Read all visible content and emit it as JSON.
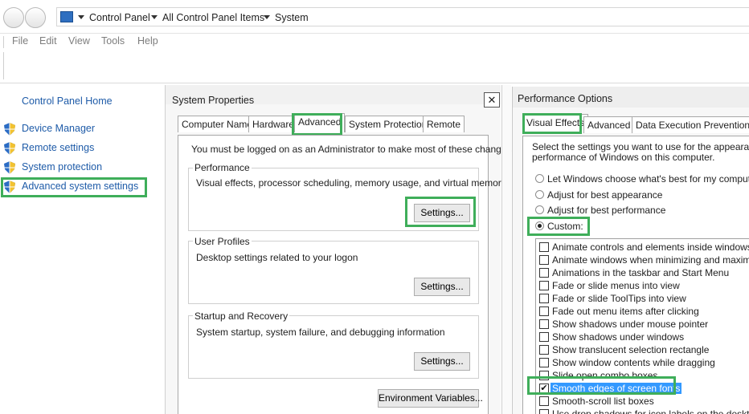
{
  "explorer": {
    "breadcrumb": [
      "Control Panel",
      "All Control Panel Items",
      "System"
    ],
    "menu": [
      "File",
      "Edit",
      "View",
      "Tools",
      "Help"
    ]
  },
  "left_nav": {
    "home": "Control Panel Home",
    "items": [
      "Device Manager",
      "Remote settings",
      "System protection",
      "Advanced system settings"
    ]
  },
  "system_properties": {
    "title": "System Properties",
    "close": "✕",
    "tabs": [
      "Computer Name",
      "Hardware",
      "Advanced",
      "System Protection",
      "Remote"
    ],
    "active_tab": "Advanced",
    "admin_note": "You must be logged on as an Administrator to make most of these changes.",
    "performance": {
      "title": "Performance",
      "desc": "Visual effects, processor scheduling, memory usage, and virtual memory",
      "button": "Settings..."
    },
    "user_profiles": {
      "title": "User Profiles",
      "desc": "Desktop settings related to your logon",
      "button": "Settings..."
    },
    "startup_recovery": {
      "title": "Startup and Recovery",
      "desc": "System startup, system failure, and debugging information",
      "button": "Settings..."
    },
    "env_button": "Environment Variables..."
  },
  "performance_options": {
    "title": "Performance Options",
    "tabs": [
      "Visual Effects",
      "Advanced",
      "Data Execution Prevention"
    ],
    "active_tab": "Visual Effects",
    "intro_line1": "Select the settings you want to use for the appearance a",
    "intro_line2": "performance of Windows on this computer.",
    "radios": [
      {
        "label": "Let Windows choose what's best for my computer",
        "selected": false
      },
      {
        "label": "Adjust for best appearance",
        "selected": false
      },
      {
        "label": "Adjust for best performance",
        "selected": false
      },
      {
        "label": "Custom:",
        "selected": true
      }
    ],
    "effects": [
      {
        "label": "Animate controls and elements inside windows",
        "checked": false
      },
      {
        "label": "Animate windows when minimizing and maximizing",
        "checked": false
      },
      {
        "label": "Animations in the taskbar and Start Menu",
        "checked": false
      },
      {
        "label": "Fade or slide menus into view",
        "checked": false
      },
      {
        "label": "Fade or slide ToolTips into view",
        "checked": false
      },
      {
        "label": "Fade out menu items after clicking",
        "checked": false
      },
      {
        "label": "Show shadows under mouse pointer",
        "checked": false
      },
      {
        "label": "Show shadows under windows",
        "checked": false
      },
      {
        "label": "Show translucent selection rectangle",
        "checked": false
      },
      {
        "label": "Show window contents while dragging",
        "checked": false
      },
      {
        "label": "Slide open combo boxes",
        "checked": false
      },
      {
        "label": "Smooth edges of screen fonts",
        "checked": true,
        "selected": true
      },
      {
        "label": "Smooth-scroll list boxes",
        "checked": false
      },
      {
        "label": "Use drop shadows for icon labels on the desktop",
        "checked": false
      }
    ],
    "check_glyph": "✔"
  },
  "colors": {
    "highlight": "#3fae5a",
    "link": "#1e5ba8",
    "selection": "#3399ff"
  }
}
